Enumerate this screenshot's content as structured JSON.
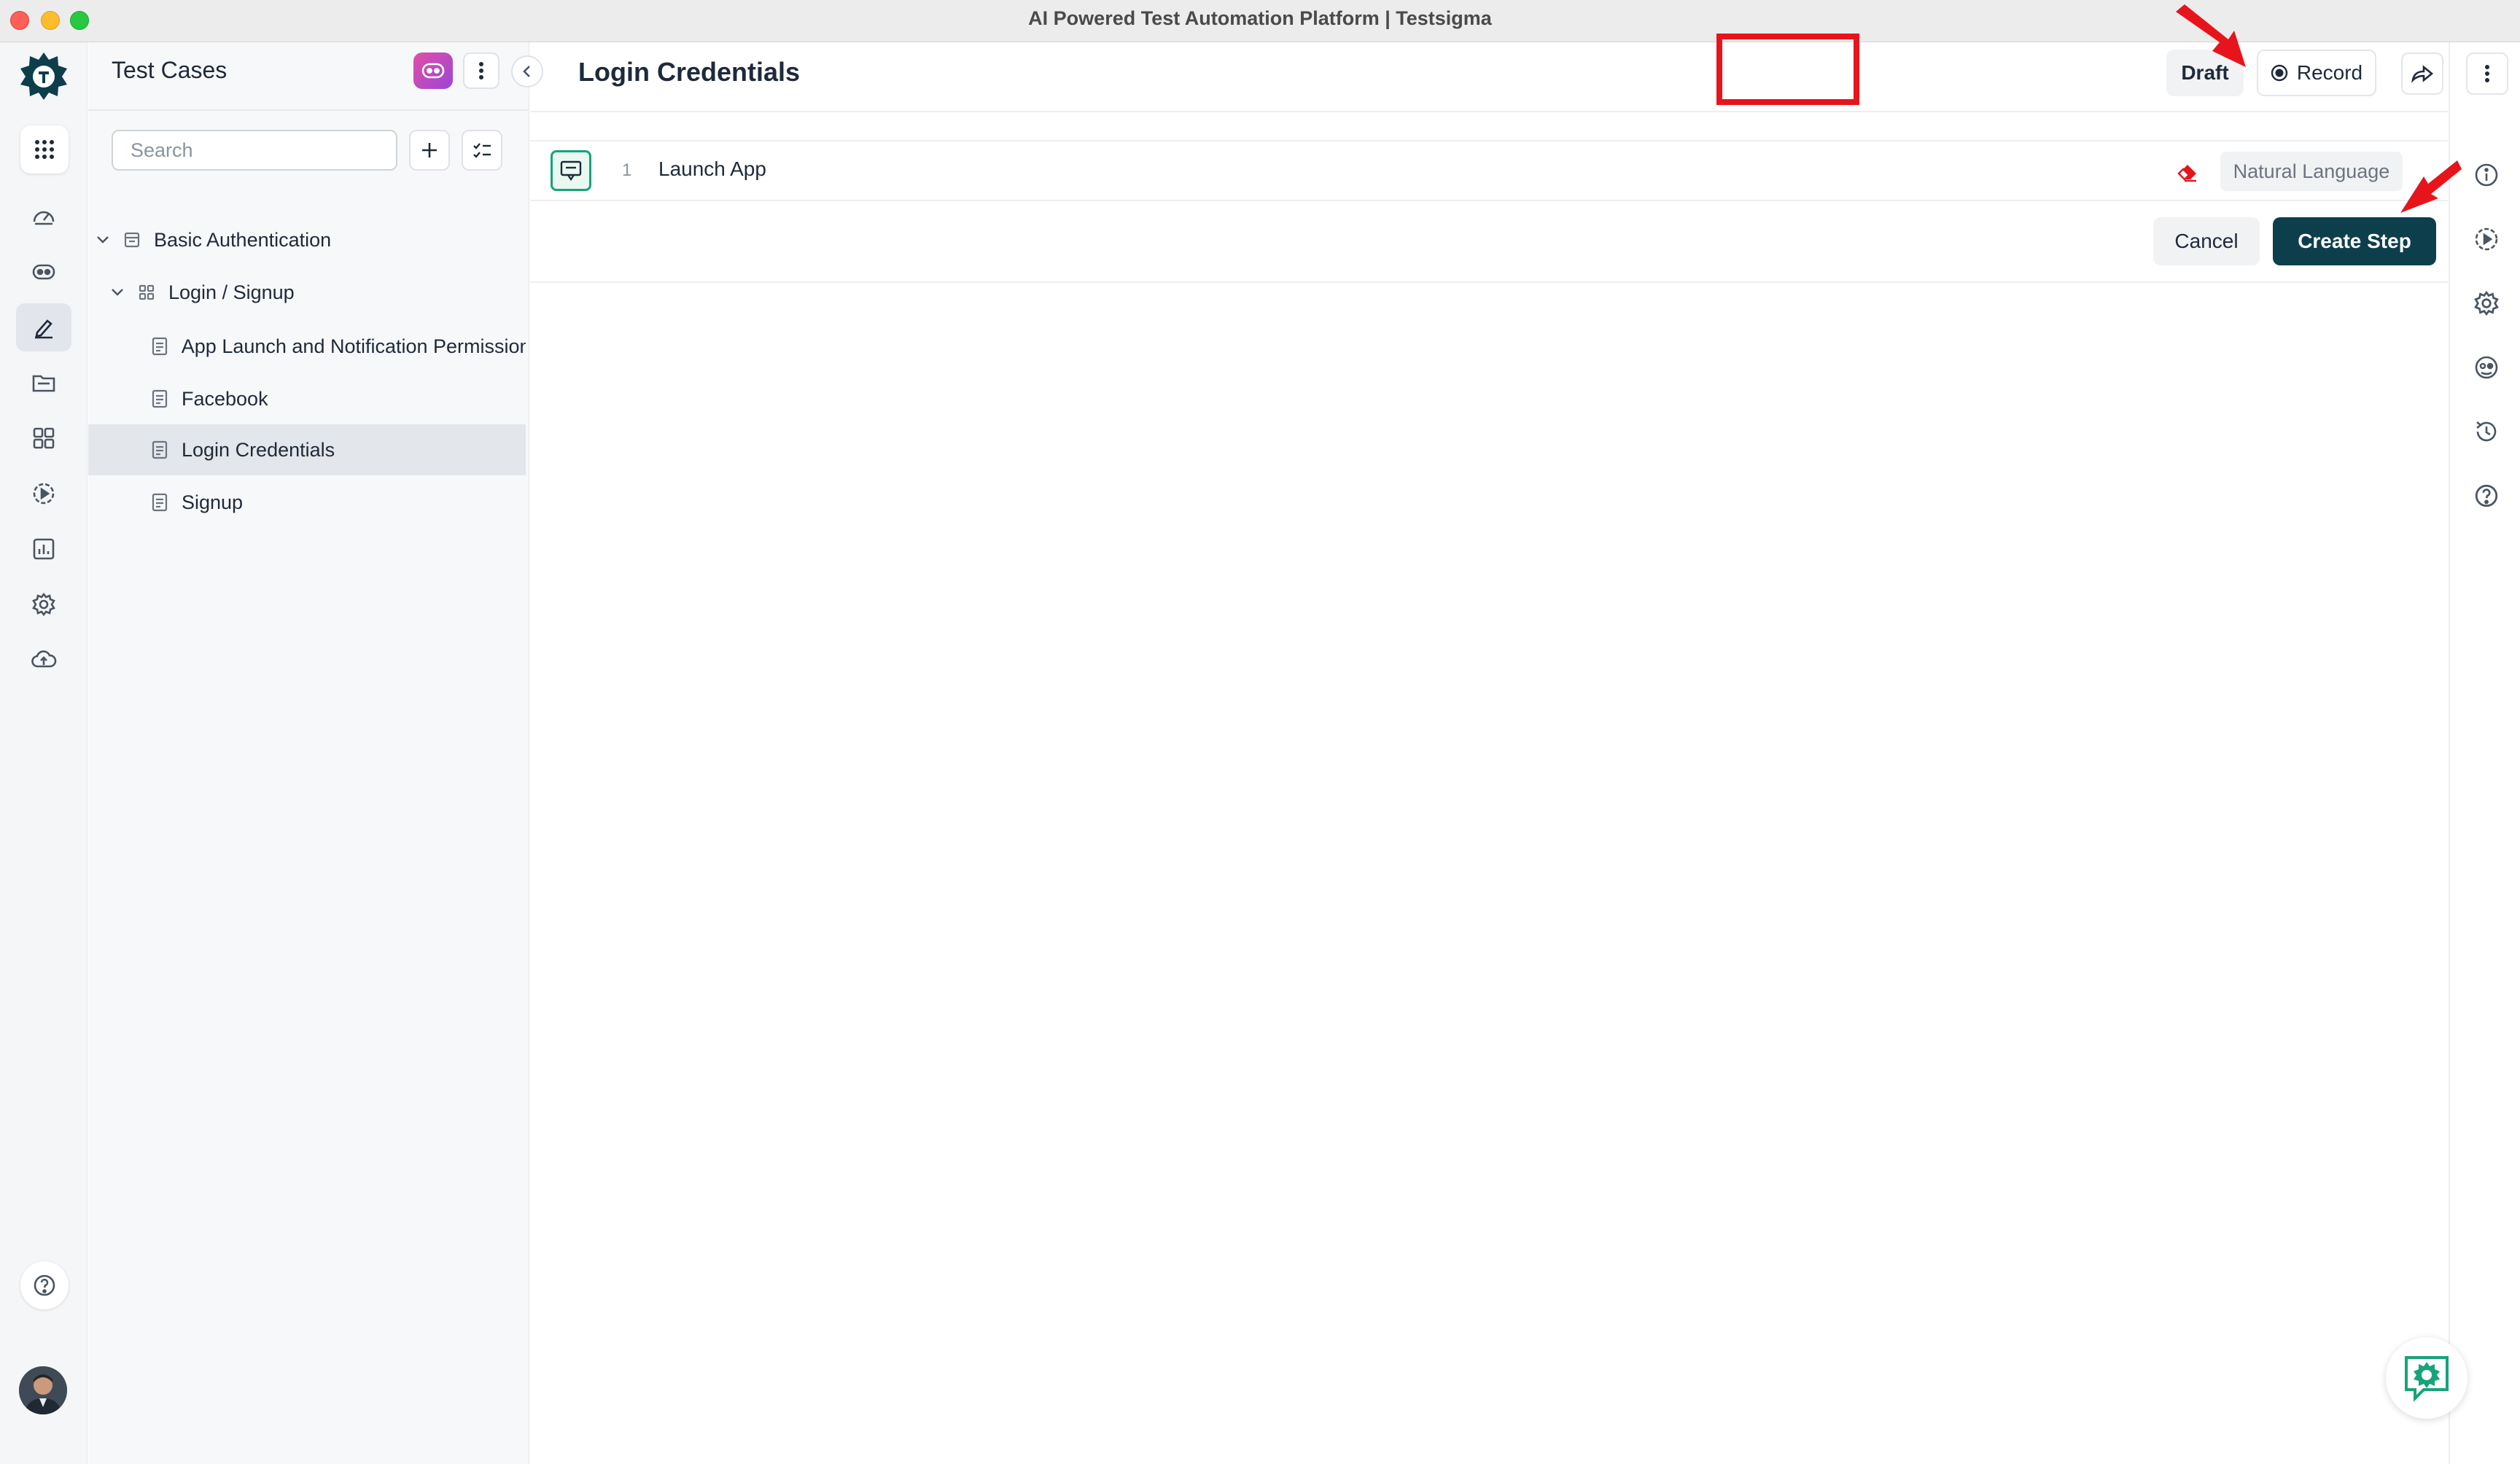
{
  "window": {
    "title": "AI Powered Test Automation Platform | Testsigma"
  },
  "rail": {
    "items": [
      {
        "icon": "dashboard-icon"
      },
      {
        "icon": "copilot-icon"
      },
      {
        "icon": "test-development-icon",
        "active": true
      },
      {
        "icon": "test-data-folder-icon"
      },
      {
        "icon": "addons-grid-icon"
      },
      {
        "icon": "run-play-icon"
      },
      {
        "icon": "reports-chart-icon"
      },
      {
        "icon": "settings-gear-icon"
      },
      {
        "icon": "cloud-upload-icon"
      }
    ]
  },
  "panel": {
    "title": "Test Cases",
    "search": {
      "placeholder": "Search",
      "value": ""
    },
    "tree": {
      "suite": "Basic Authentication",
      "group": "Login / Signup",
      "cases": [
        "App Launch and Notification Permissions",
        "Facebook",
        "Login Credentials",
        "Signup"
      ],
      "selected": "Login Credentials"
    }
  },
  "main": {
    "title": "Login Credentials",
    "status": "Draft",
    "record_label": "Record",
    "steps": [
      {
        "number": "1",
        "text": "Launch App",
        "mode": "Natural Language"
      }
    ],
    "cancel_label": "Cancel",
    "create_label": "Create Step"
  },
  "colors": {
    "primary": "#0d3e4c",
    "accent_green": "#18a37a",
    "annotation_red": "#e8141c",
    "copilot_gradient_start": "#e24fa6",
    "copilot_gradient_end": "#9a46d6"
  }
}
